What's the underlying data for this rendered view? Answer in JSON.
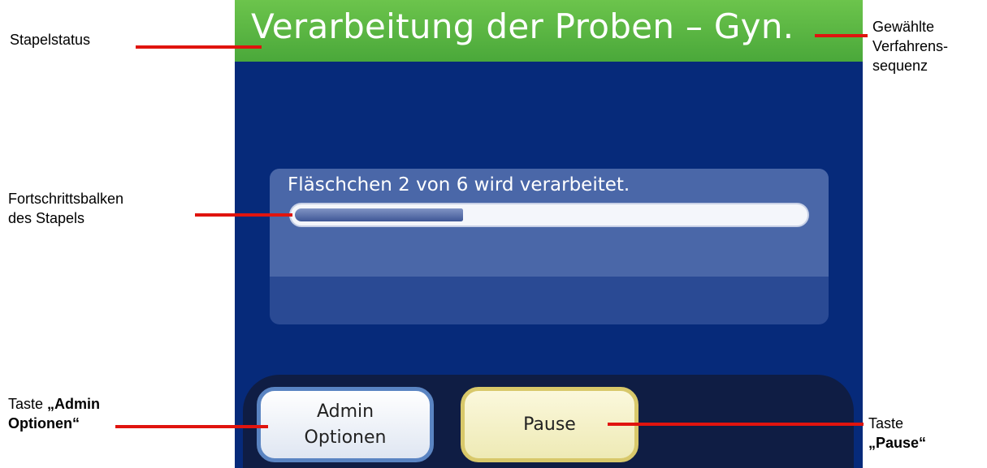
{
  "screen": {
    "title": "Verarbeitung der Proben – Gyn.",
    "status": {
      "message": "Fläschchen 2 von 6 wird verarbeitet.",
      "progress_fraction": 0.33
    },
    "buttons": {
      "admin_line1": "Admin",
      "admin_line2": "Optionen",
      "pause": "Pause"
    }
  },
  "annotations": {
    "stapelstatus": "Stapelstatus",
    "sequence_line1": "Gewählte",
    "sequence_line2": "Verfahrens-",
    "sequence_line3": "sequenz",
    "progress_line1": "Fortschrittsbalken",
    "progress_line2": "des Stapels",
    "admin_prefix": "Taste ",
    "admin_bold1": "„Admin",
    "admin_bold2": "Optionen“",
    "pause_prefix": "Taste",
    "pause_bold": "„Pause“"
  },
  "colors": {
    "leader": "#e0140e",
    "title_bar": "#4aa83a",
    "screen_bg": "#062a7a"
  }
}
